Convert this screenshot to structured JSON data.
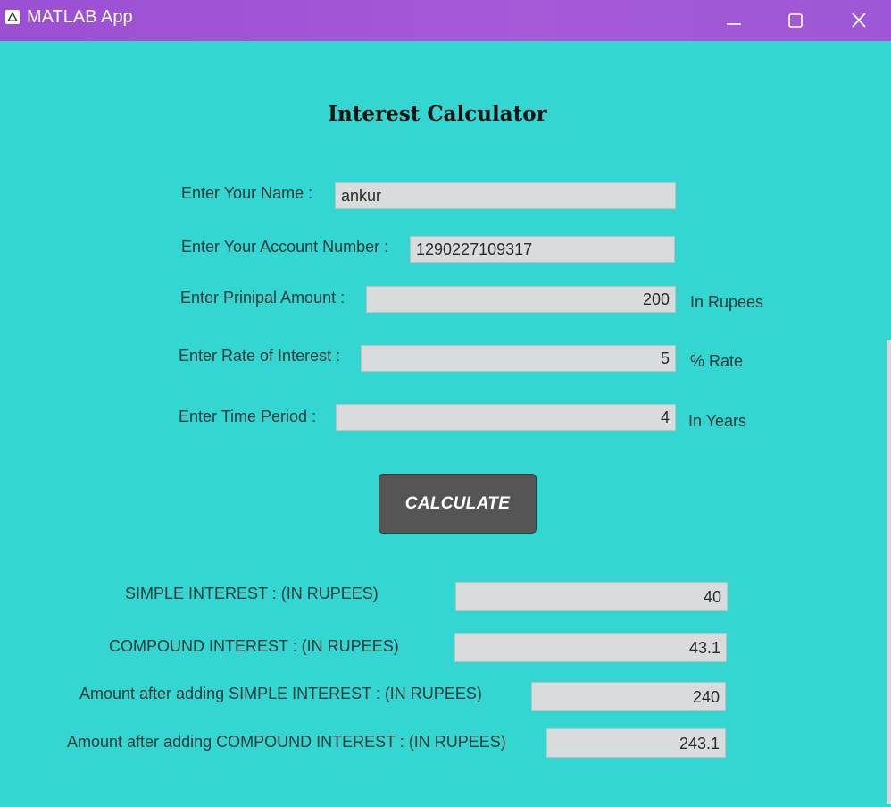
{
  "window": {
    "title": "MATLAB App",
    "icon": "matlab-icon"
  },
  "controls": {
    "minimize_icon": "minimize-icon",
    "maximize_icon": "maximize-icon",
    "close_icon": "close-icon"
  },
  "colors": {
    "titlebar": "#9b4fd3",
    "background": "#33d6d0",
    "field": "#d8dcdc",
    "button": "#555555"
  },
  "heading": "Interest Calculator",
  "form": {
    "name_label": "Enter Your Name :",
    "name_value": "ankur",
    "account_label": "Enter Your Account Number :",
    "account_value": "1290227109317",
    "principal_label": "Enter Prinipal Amount :",
    "principal_value": "200",
    "principal_unit": "In Rupees",
    "rate_label": "Enter Rate of Interest :",
    "rate_value": "5",
    "rate_unit": "% Rate",
    "time_label": "Enter Time Period :",
    "time_value": "4",
    "time_unit": "In Years"
  },
  "calculate_label": "CALCULATE",
  "results": {
    "simple_label": "SIMPLE INTEREST :  (IN RUPEES)",
    "simple_value": "40",
    "compound_label": "COMPOUND INTEREST :  (IN RUPEES)",
    "compound_value": "43.1",
    "amount_simple_label": "Amount after adding SIMPLE INTEREST :  (IN RUPEES)",
    "amount_simple_value": "240",
    "amount_compound_label": "Amount after adding COMPOUND INTEREST :  (IN RUPEES)",
    "amount_compound_value": "243.1"
  }
}
